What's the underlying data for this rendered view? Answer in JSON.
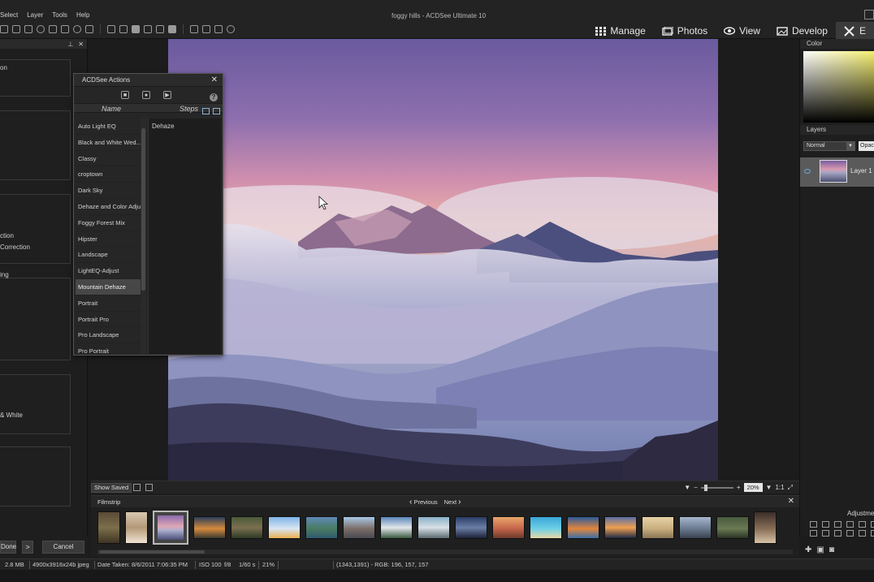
{
  "window": {
    "title": "foggy hills - ACDSee Ultimate 10"
  },
  "menu": [
    "Select",
    "Layer",
    "Tools",
    "Help"
  ],
  "modes": [
    {
      "label": "Manage",
      "icon": "grid-icon"
    },
    {
      "label": "Photos",
      "icon": "photos-icon"
    },
    {
      "label": "View",
      "icon": "eye-icon"
    },
    {
      "label": "Develop",
      "icon": "develop-icon"
    },
    {
      "label": "E",
      "icon": "edit-icon"
    }
  ],
  "left_panel": {
    "texts": [
      "on",
      "ction",
      "Correction",
      "ing",
      "& White"
    ]
  },
  "actions_dialog": {
    "title": "ACDSee Actions",
    "col_name": "Name",
    "col_steps": "Steps",
    "help": "?",
    "items": [
      "Auto Light EQ",
      "Black and White Wed...",
      "Classy",
      "croptown",
      "Dark Sky",
      "Dehaze and Color Adjust",
      "Foggy Forest Mix",
      "Hipster",
      "Landscape",
      "LightEQ-Adjust",
      "Mountain Dehaze",
      "Portrait",
      "Portrait Pro",
      "Pro Landscape",
      "Pro Portrait"
    ],
    "selected_index": 10,
    "steps": [
      "Dehaze"
    ]
  },
  "right_panel": {
    "color_tab": "Color",
    "layers_tab": "Layers",
    "blend_mode": "Normal",
    "opacity_label": "Opaci",
    "layer_name": "Layer 1",
    "adjust_label": "Adjustme"
  },
  "image_bar": {
    "show_saved": "Show Saved",
    "zoom": "20%"
  },
  "filmstrip": {
    "title": "Filmstrip",
    "previous": "Previous",
    "next": "Next"
  },
  "buttons": {
    "done": "Done",
    "arrow": ">",
    "cancel": "Cancel"
  },
  "status": {
    "file_size": "2.8 MB",
    "dimensions": "4900x3916x24b jpeg",
    "date_taken": "Date Taken: 8/6/2011 7:06:35 PM",
    "iso": "ISO 100",
    "aperture": "f/8",
    "shutter": "1/60 s",
    "zoom": "21%",
    "pixel_info": "(1343,1391) - RGB: 196, 157, 157"
  },
  "colors": {
    "accent_blue": "#6fa6d8",
    "bg_dark": "#1c1c1c",
    "panel": "#1e1e1e"
  }
}
